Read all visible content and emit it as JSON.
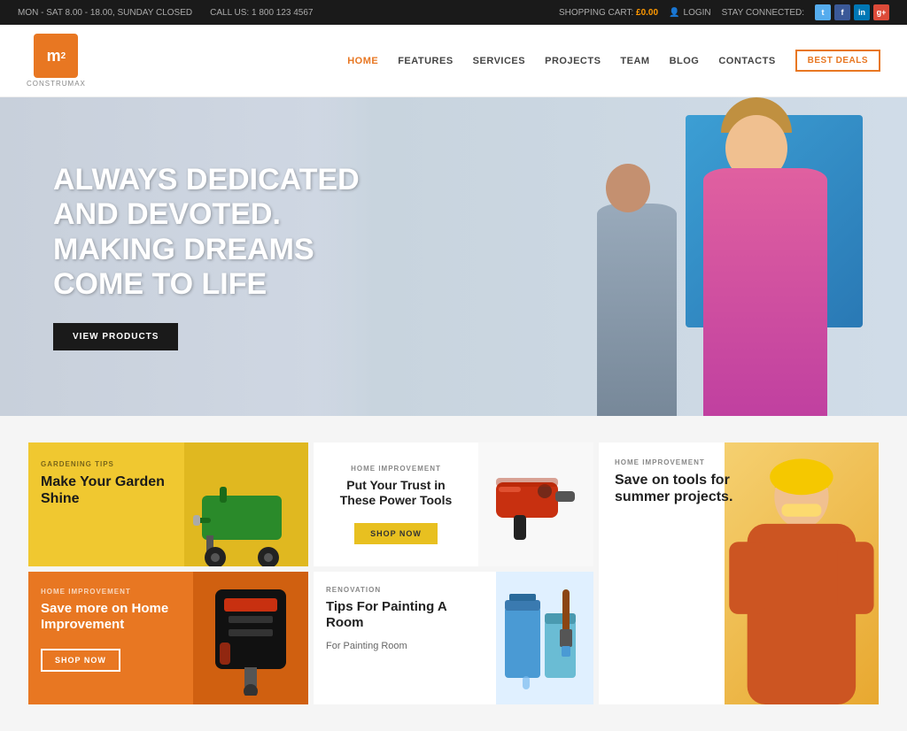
{
  "topbar": {
    "hours": "MON - SAT 8.00 - 18.00, SUNDAY CLOSED",
    "phone_label": "CALL US: 1 800 123 4567",
    "cart_label": "SHOPPING CART:",
    "cart_amount": "£0.00",
    "login_label": "LOGIN",
    "stay_connected": "STAY CONNECTED:",
    "social": [
      "Twitter",
      "Facebook",
      "LinkedIn",
      "Google+"
    ]
  },
  "header": {
    "logo_text": "m²",
    "logo_subtitle": "CONSTRUMAX",
    "nav": [
      {
        "label": "HOME",
        "active": true
      },
      {
        "label": "FEATURES",
        "active": false
      },
      {
        "label": "SERVICES",
        "active": false
      },
      {
        "label": "PROJECTS",
        "active": false
      },
      {
        "label": "TEAM",
        "active": false
      },
      {
        "label": "BLOG",
        "active": false
      },
      {
        "label": "CONTACTS",
        "active": false
      }
    ],
    "best_deals": "BEST DEALS"
  },
  "hero": {
    "title_line1": "ALWAYS DEDICATED",
    "title_line2": "AND DEVOTED.",
    "title_line3": "MAKING DREAMS",
    "title_line4": "COME TO LIFE",
    "cta_button": "VIEW PRODUCTS"
  },
  "cards": [
    {
      "id": "card1",
      "category": "GARDENING TIPS",
      "title": "Make Your Garden Shine",
      "color": "yellow"
    },
    {
      "id": "card2",
      "category": "HOME IMPROVEMENT",
      "title": "Put Your Trust in These Power Tools",
      "shop_label": "SHOP NOW",
      "color": "white"
    },
    {
      "id": "card3",
      "category": "HOME IMPROVEMENT",
      "title": "Save on tools for summer projects.",
      "color": "white",
      "tall": true
    },
    {
      "id": "card4",
      "category": "HOME IMPROVEMENT",
      "title": "Save more on Home Improvement",
      "shop_label": "SHOP NOW",
      "color": "orange"
    },
    {
      "id": "card5",
      "category": "RENOVATION",
      "title": "Tips For Painting A Room",
      "subtitle": "For Painting Room",
      "color": "white"
    }
  ]
}
